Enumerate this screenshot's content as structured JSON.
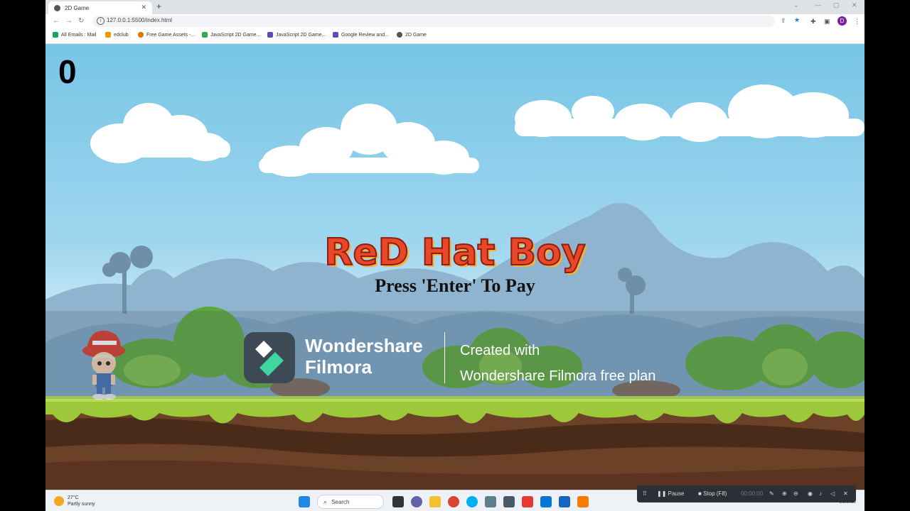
{
  "browser": {
    "tab_title": "2D Game",
    "new_tab": "+",
    "url": "127.0.0.1:5500/index.html",
    "profile_initial": "D",
    "bookmarks": [
      {
        "label": "All Emails : Mail",
        "color": "#1aa260"
      },
      {
        "label": "edclub",
        "color": "#f29900"
      },
      {
        "label": "Free Game Assets -...",
        "color": "#e37400"
      },
      {
        "label": "JavaScript 2D Game...",
        "color": "#34a853"
      },
      {
        "label": "JavaScript 2D Game...",
        "color": "#5f4bb6"
      },
      {
        "label": "Google Review and...",
        "color": "#5f4bb6"
      },
      {
        "label": "2D Game",
        "color": "#555555"
      }
    ]
  },
  "game": {
    "score": "0",
    "title": "ReD Hat Boy",
    "prompt": "Press 'Enter' To Pay"
  },
  "watermark": {
    "brand_line1": "Wondershare",
    "brand_line2": "Filmora",
    "created_line1": "Created with",
    "created_line2": "Wondershare Filmora free plan"
  },
  "taskbar": {
    "temperature": "27°C",
    "weather": "Partly sunny",
    "search_label": "Search",
    "date": "5/3/2023"
  },
  "recorder": {
    "pause_label": "Pause",
    "stop_label": "Stop",
    "stop_key": "(F8)",
    "time": "00:00:00"
  },
  "colors": {
    "sky": "#76c5e6",
    "grass": "#9cc83a",
    "dirt": "#6b4127",
    "title_red": "#e8472a"
  }
}
